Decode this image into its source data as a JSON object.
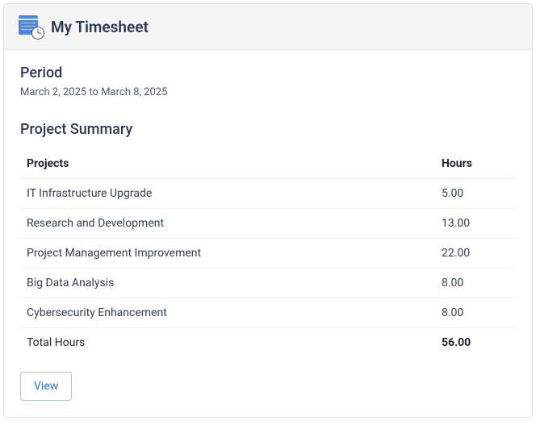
{
  "header": {
    "title": "My Timesheet"
  },
  "period": {
    "label": "Period",
    "range": "March 2, 2025 to March 8, 2025"
  },
  "summary": {
    "title": "Project Summary",
    "columns": {
      "projects": "Projects",
      "hours": "Hours"
    },
    "rows": [
      {
        "name": "IT Infrastructure Upgrade",
        "hours": "5.00"
      },
      {
        "name": "Research and Development",
        "hours": "13.00"
      },
      {
        "name": "Project Management Improvement",
        "hours": "22.00"
      },
      {
        "name": "Big Data Analysis",
        "hours": "8.00"
      },
      {
        "name": "Cybersecurity Enhancement",
        "hours": "8.00"
      }
    ],
    "total": {
      "label": "Total Hours",
      "hours": "56.00"
    }
  },
  "actions": {
    "view": "View"
  }
}
